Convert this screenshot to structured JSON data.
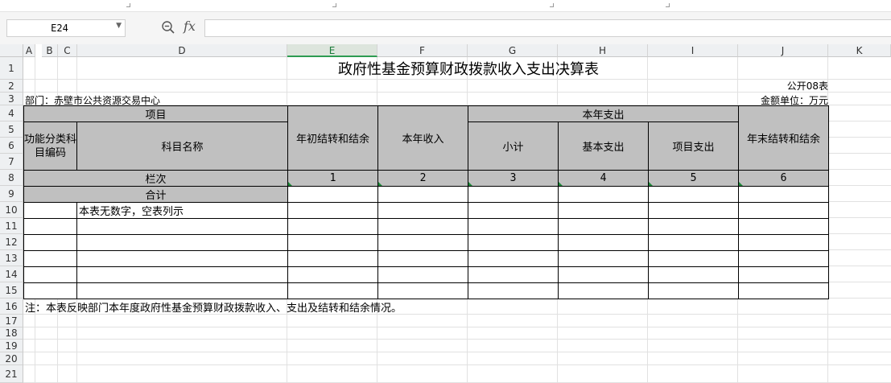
{
  "name_box": "E24",
  "formula_bar": {
    "fx_label": "fx",
    "content": ""
  },
  "columns": [
    "A",
    "B",
    "C",
    "D",
    "E",
    "F",
    "G",
    "H",
    "I",
    "J",
    "K"
  ],
  "selected_column": "E",
  "rows": [
    "1",
    "2",
    "3",
    "4",
    "5",
    "6",
    "7",
    "8",
    "9",
    "10",
    "11",
    "12",
    "13",
    "14",
    "15",
    "16",
    "17",
    "18",
    "19",
    "20",
    "21"
  ],
  "report": {
    "title": "政府性基金预算财政拨款收入支出决算表",
    "form_no": "公开08表",
    "department": "部门：赤壁市公共资源交易中心",
    "unit": "金额单位：万元",
    "headers": {
      "project": "项目",
      "func_code": "功能分类科目编码",
      "subject_name": "科目名称",
      "opening_balance": "年初结转和结余",
      "income": "本年收入",
      "expense": "本年支出",
      "subtotal": "小计",
      "basic": "基本支出",
      "project_exp": "项目支出",
      "closing_balance": "年末结转和结余"
    },
    "column_index_label": "栏次",
    "column_indices": [
      "1",
      "2",
      "3",
      "4",
      "5",
      "6"
    ],
    "total_label": "合计",
    "empty_note": "本表无数字，空表列示",
    "footnote": "注：本表反映部门本年度政府性基金预算财政拨款收入、支出及结转和结余情况。"
  },
  "colors": {
    "header_fill": "#c0c0c0",
    "selected_col": "#2e9b52"
  }
}
